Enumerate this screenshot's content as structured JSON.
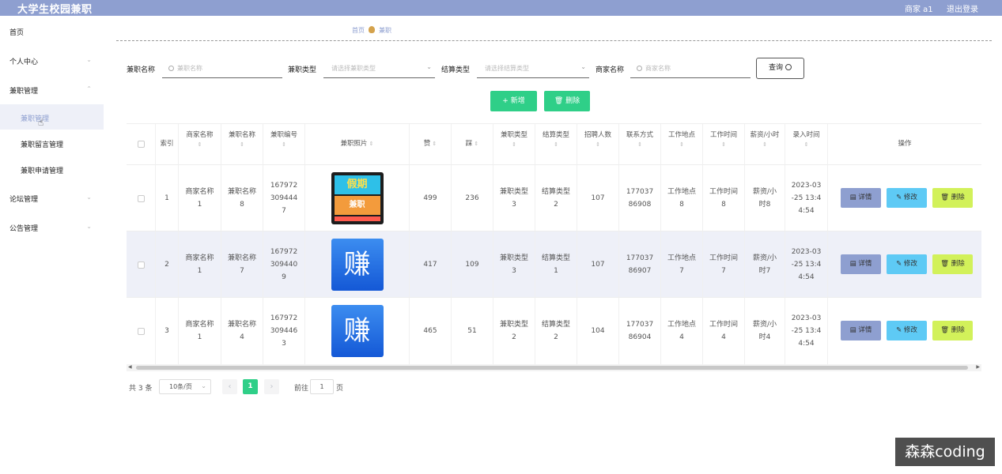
{
  "header": {
    "title": "大学生校园兼职",
    "user": "商家 a1",
    "logout": "退出登录"
  },
  "sidebar": {
    "items": [
      {
        "label": "首页"
      },
      {
        "label": "个人中心",
        "arrow": "⌄"
      },
      {
        "label": "兼职管理",
        "arrow": "⌃"
      },
      {
        "label": "论坛管理",
        "arrow": "⌄"
      },
      {
        "label": "公告管理",
        "arrow": "⌄"
      }
    ],
    "sub_items": [
      {
        "label": "兼职管理"
      },
      {
        "label": "兼职留言管理"
      },
      {
        "label": "兼职申请管理"
      }
    ]
  },
  "breadcrumb": {
    "home": "首页",
    "current": "兼职"
  },
  "filters": {
    "name_label": "兼职名称",
    "name_placeholder": "兼职名称",
    "type_label": "兼职类型",
    "type_placeholder": "请选择兼职类型",
    "settle_label": "结算类型",
    "settle_placeholder": "请选择结算类型",
    "merchant_label": "商家名称",
    "merchant_placeholder": "商家名称",
    "query_button": "查询"
  },
  "toolbar": {
    "add_label": "+ 新增",
    "delete_label": "删除"
  },
  "table": {
    "headers": {
      "index": "索引",
      "merchant": "商家名称",
      "name": "兼职名称",
      "code": "兼职编号",
      "photo": "兼职照片",
      "like": "赞",
      "dislike": "踩",
      "type": "兼职类型",
      "settle": "结算类型",
      "count": "招聘人数",
      "contact": "联系方式",
      "place": "工作地点",
      "time": "工作时间",
      "salary": "薪资/小时",
      "entered": "录入时间",
      "ops": "操作"
    },
    "rows": [
      {
        "index": "1",
        "merchant": "商家名称1",
        "name": "兼职名称8",
        "code": "1679723094447",
        "photo": "poster",
        "like": "499",
        "dislike": "236",
        "type": "兼职类型3",
        "settle": "结算类型2",
        "count": "107",
        "contact": "17703786908",
        "place": "工作地点8",
        "time": "工作时间8",
        "salary": "薪资/小时8",
        "entered": "2023-03-25 13:44:54"
      },
      {
        "index": "2",
        "merchant": "商家名称1",
        "name": "兼职名称7",
        "code": "1679723094409",
        "photo": "赚",
        "like": "417",
        "dislike": "109",
        "type": "兼职类型3",
        "settle": "结算类型1",
        "count": "107",
        "contact": "17703786907",
        "place": "工作地点7",
        "time": "工作时间7",
        "salary": "薪资/小时7",
        "entered": "2023-03-25 13:44:54"
      },
      {
        "index": "3",
        "merchant": "商家名称1",
        "name": "兼职名称4",
        "code": "1679723094463",
        "photo": "赚",
        "like": "465",
        "dislike": "51",
        "type": "兼职类型2",
        "settle": "结算类型2",
        "count": "104",
        "contact": "17703786904",
        "place": "工作地点4",
        "time": "工作时间4",
        "salary": "薪资/小时4",
        "entered": "2023-03-25 13:44:54"
      }
    ],
    "actions": {
      "detail": "详情",
      "edit": "修改",
      "remove": "删除"
    }
  },
  "poster_text": {
    "top": "假期",
    "bottom": "兼职"
  },
  "pagination": {
    "total": "共 3 条",
    "page_size": "10条/页",
    "current": "1",
    "goto_label": "前往",
    "goto_value": "1",
    "page_suffix": "页"
  },
  "watermark": "森森coding"
}
